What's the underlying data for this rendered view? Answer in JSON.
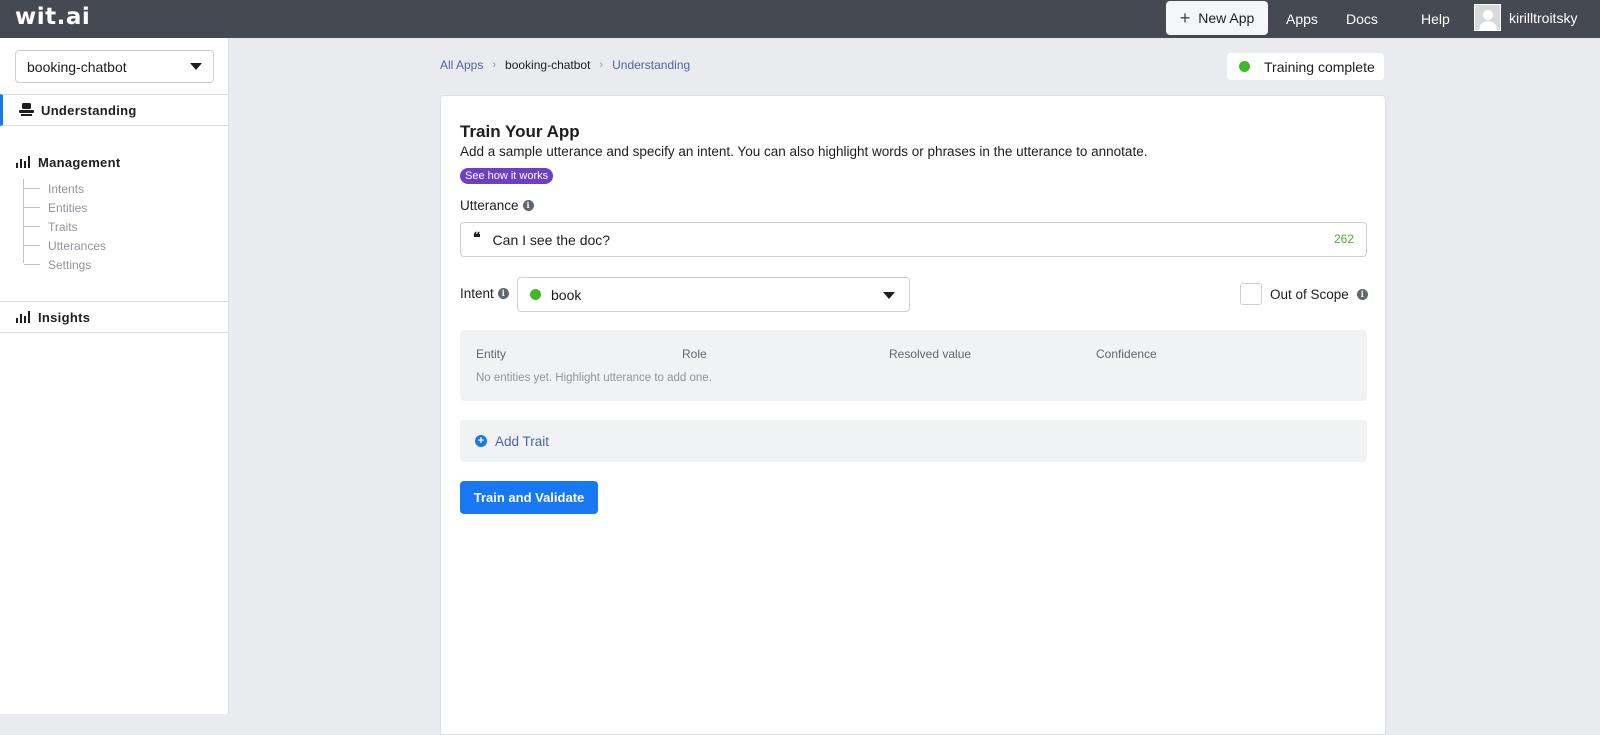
{
  "header": {
    "logo": "wit.ai",
    "new_app_label": "New App",
    "nav": {
      "apps": "Apps",
      "docs": "Docs",
      "help": "Help"
    },
    "username": "kirilltroitsky"
  },
  "sidebar": {
    "app_selector": "booking-chatbot",
    "understanding": "Understanding",
    "management": "Management",
    "management_items": [
      "Intents",
      "Entities",
      "Traits",
      "Utterances",
      "Settings"
    ],
    "insights": "Insights"
  },
  "breadcrumb": {
    "all_apps": "All Apps",
    "app": "booking-chatbot",
    "current": "Understanding"
  },
  "status": {
    "text": "Training complete",
    "color": "#42b72a"
  },
  "train": {
    "title": "Train Your App",
    "description": "Add a sample utterance and specify an intent. You can also highlight words or phrases in the utterance to annotate.",
    "see_how": "See how it works",
    "utterance_label": "Utterance",
    "utterance_value": "Can I see the doc?",
    "char_count": "262",
    "intent_label": "Intent",
    "intent_value": "book",
    "intent_color": "#42b72a",
    "out_of_scope_label": "Out of Scope",
    "out_of_scope_checked": false,
    "entity_table": {
      "headers": [
        "Entity",
        "Role",
        "Resolved value",
        "Confidence"
      ],
      "empty_text": "No entities yet. Highlight utterance to add one."
    },
    "add_trait": "Add Trait",
    "submit": "Train and Validate"
  },
  "colors": {
    "accent": "#1877f2",
    "topbar": "#454a52",
    "badge": "#6c3fc9"
  }
}
